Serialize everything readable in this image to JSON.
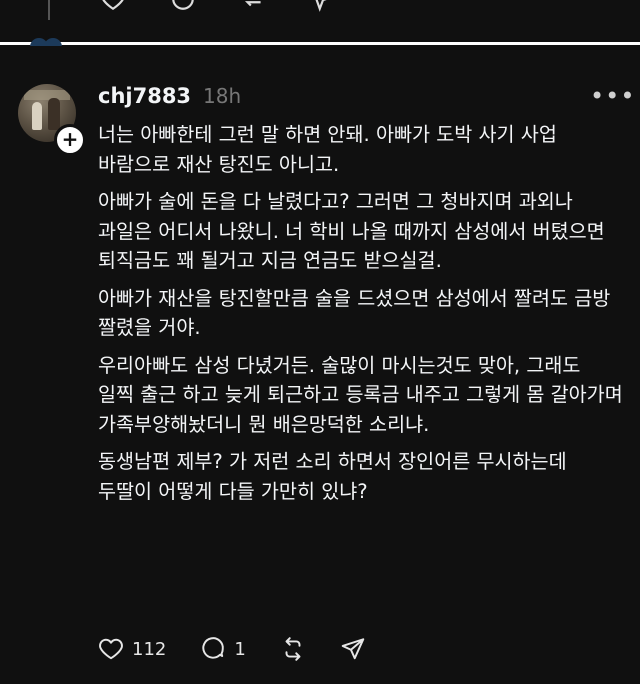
{
  "previous_post": {
    "icons": [
      "heart-icon",
      "comment-icon",
      "repost-icon",
      "share-icon"
    ]
  },
  "post": {
    "username": "chj7883",
    "time": "18h",
    "more": "•••",
    "paragraphs": [
      "너는 아빠한테 그런 말 하면 안돼. 아빠가 도박 사기 사업 바람으로 재산 탕진도 아니고.",
      "아빠가 술에 돈을 다 날렸다고? 그러면 그 청바지며 과외나 과일은 어디서 나왔니. 너 학비 나올 때까지 삼성에서 버텼으면  퇴직금도 꽤 될거고 지금 연금도 받으실걸.",
      "아빠가 재산을 탕진할만큼 술을 드셨으면 삼성에서 짤려도 금방 짤렸을 거야.",
      "우리아빠도 삼성 다녔거든. 술많이 마시는것도 맞아, 그래도  일찍 출근 하고 늦게 퇴근하고 등록금 내주고 그렇게 몸 갈아가며 가족부양해놨더니 뭔 배은망덕한 소리냐.",
      "동생남편 제부? 가 저런 소리 하면서 장인어른 무시하는데 두딸이 어떻게 다들 가만히 있냐?"
    ],
    "actions": {
      "likes": "112",
      "comments": "1"
    }
  }
}
